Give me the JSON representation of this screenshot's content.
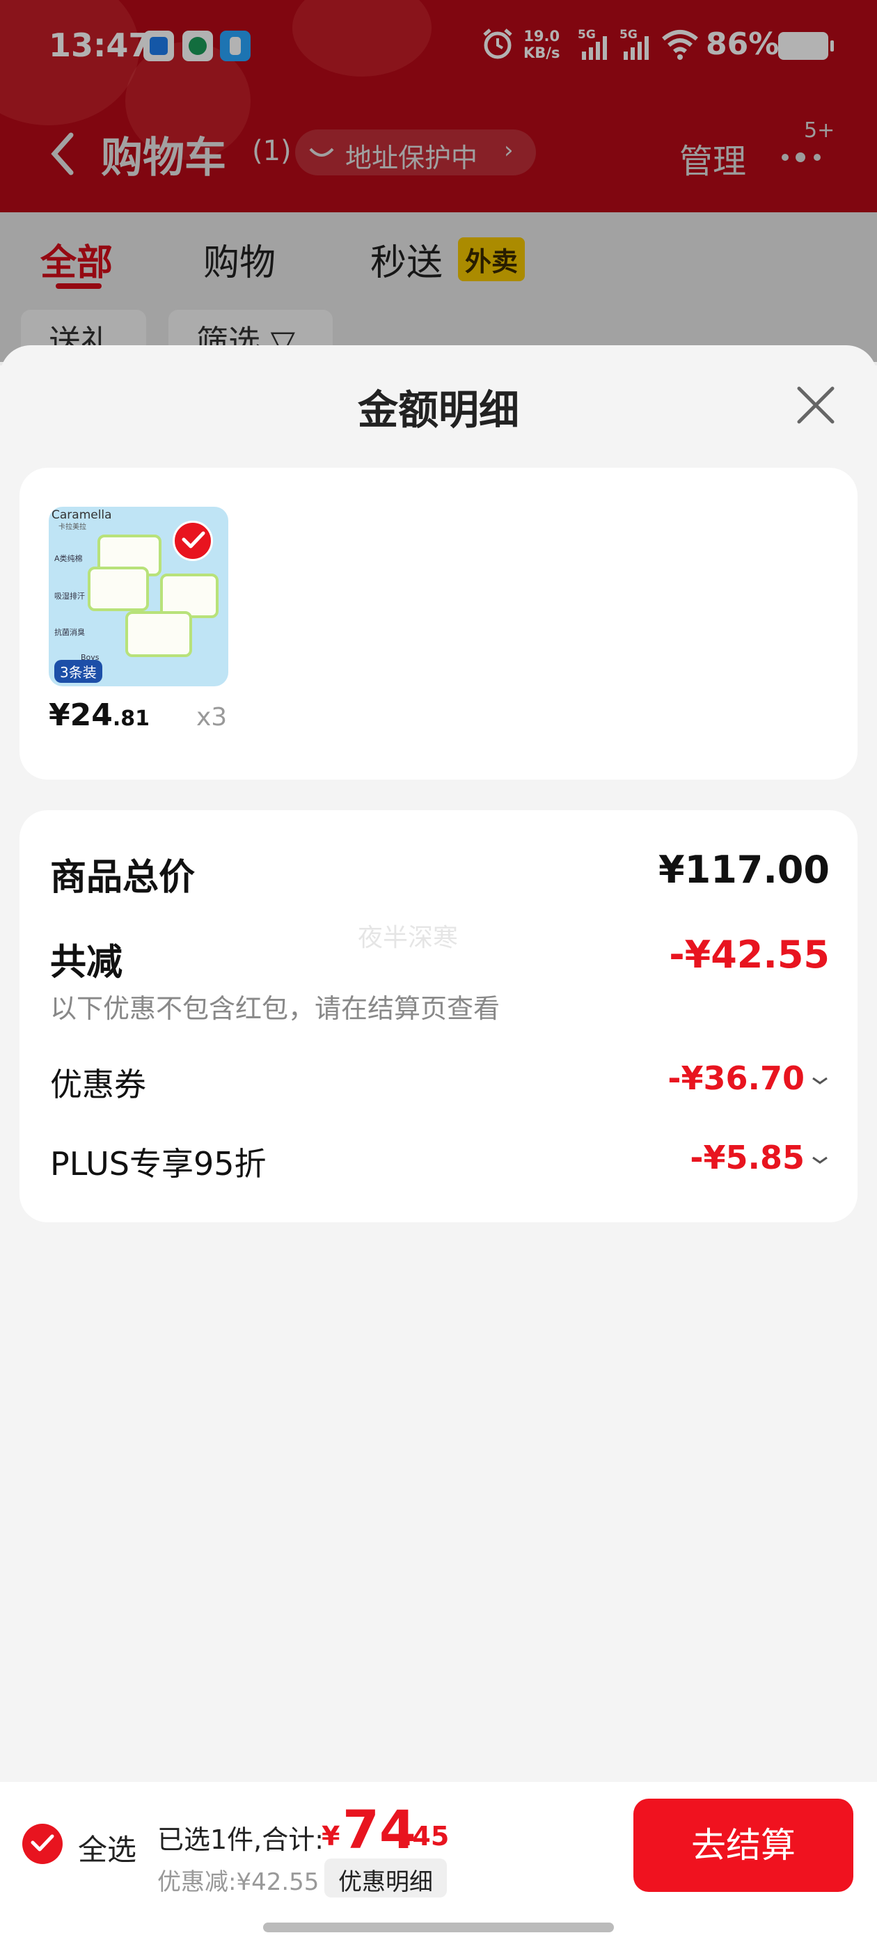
{
  "status_bar": {
    "time": "13:47",
    "net_speed_value": "19.0",
    "net_speed_unit": "KB/s",
    "signal1_label": "5G",
    "signal2_label": "5G",
    "battery": "86%"
  },
  "header": {
    "title": "购物车",
    "count": "(1)",
    "address_protection": "地址保护中",
    "manage": "管理",
    "more_badge": "5+"
  },
  "tabs": [
    {
      "label": "全部"
    },
    {
      "label": "购物"
    },
    {
      "label": "秒送"
    }
  ],
  "tab_tag": "外卖",
  "filters": [
    {
      "label": "送礼"
    },
    {
      "label": "筛选 ▽"
    }
  ],
  "sheet": {
    "title": "金额明细",
    "item": {
      "image_text": {
        "brand": "Caramella",
        "brand_sub": "卡拉美拉",
        "features": [
          "A类纯棉",
          "吸湿排汗",
          "抗菌消臭"
        ],
        "pack": "3条装",
        "boys": "Boys"
      },
      "price_currency": "¥",
      "price_int": "24",
      "price_dec": ".81",
      "quantity": "x3"
    },
    "summary": {
      "total_label": "商品总价",
      "total_value": "¥117.00",
      "reduce_label": "共减",
      "reduce_value": "-¥42.55",
      "reduce_note": "以下优惠不包含红包，请在结算页查看",
      "coupon_label": "优惠券",
      "coupon_value": "-¥36.70",
      "plus_label": "PLUS专享95折",
      "plus_value": "-¥5.85"
    },
    "watermark": "夜半深寒"
  },
  "bottom_bar": {
    "select_all": "全选",
    "summary": "已选1件,合计:",
    "total_currency": "¥",
    "total_int": "74",
    "total_dec": ".45",
    "discount": "优惠减:¥42.55",
    "detail_button": "优惠明细",
    "checkout": "去结算"
  },
  "colors": {
    "header_red": "#b80a17",
    "accent_red": "#e8141f",
    "checkout_red": "#f0121f",
    "waimai_yellow": "#f5c800"
  }
}
